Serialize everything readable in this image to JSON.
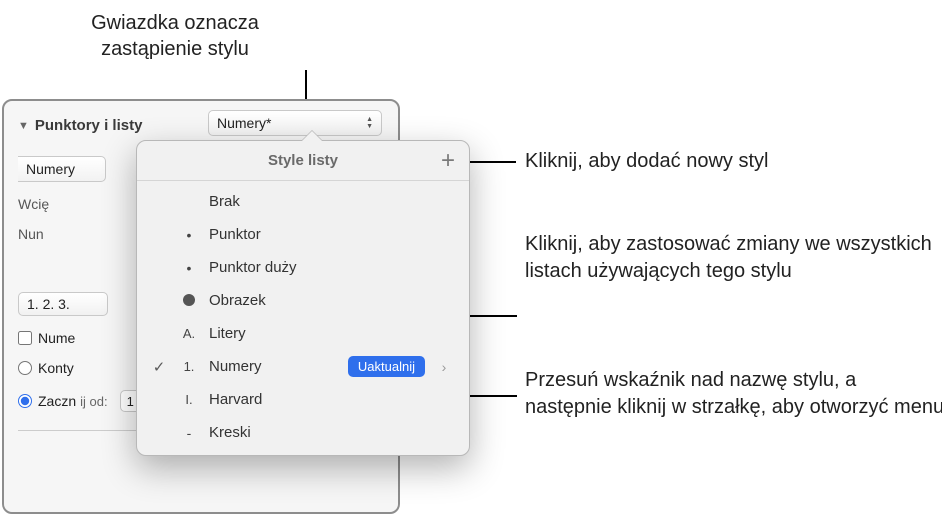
{
  "annotations": {
    "top": "Gwiazdka oznacza zastąpienie stylu",
    "add": "Kliknij, aby dodać nowy styl",
    "update": "Kliknij, aby zastosować zmiany we wszystkich listach używających tego stylu",
    "arrow": "Przesuń wskaźnik nad nazwę stylu, a następnie kliknij w strzałkę, aby otworzyć menu"
  },
  "panel": {
    "section_title": "Punktory i listy",
    "style_selected": "Numery*",
    "left_partial": "Numery",
    "label_indent": "Wcię",
    "label_num": "Nun",
    "format_selected": "1. 2. 3.",
    "checkbox_label": "Nume",
    "radio_continue": "Konty",
    "radio_startfrom": "Zaczn"
  },
  "popover": {
    "title": "Style listy",
    "items": [
      {
        "bullet": "",
        "label": "Brak",
        "selected": false
      },
      {
        "bullet": "•",
        "label": "Punktor",
        "selected": false
      },
      {
        "bullet": "•",
        "label": "Punktor duży",
        "selected": false
      },
      {
        "bullet": "img",
        "label": "Obrazek",
        "selected": false
      },
      {
        "bullet": "A.",
        "label": "Litery",
        "selected": false
      },
      {
        "bullet": "1.",
        "label": "Numery",
        "selected": true,
        "update_label": "Uaktualnij"
      },
      {
        "bullet": "I.",
        "label": "Harvard",
        "selected": false
      },
      {
        "bullet": "-",
        "label": "Kreski",
        "selected": false
      }
    ]
  }
}
